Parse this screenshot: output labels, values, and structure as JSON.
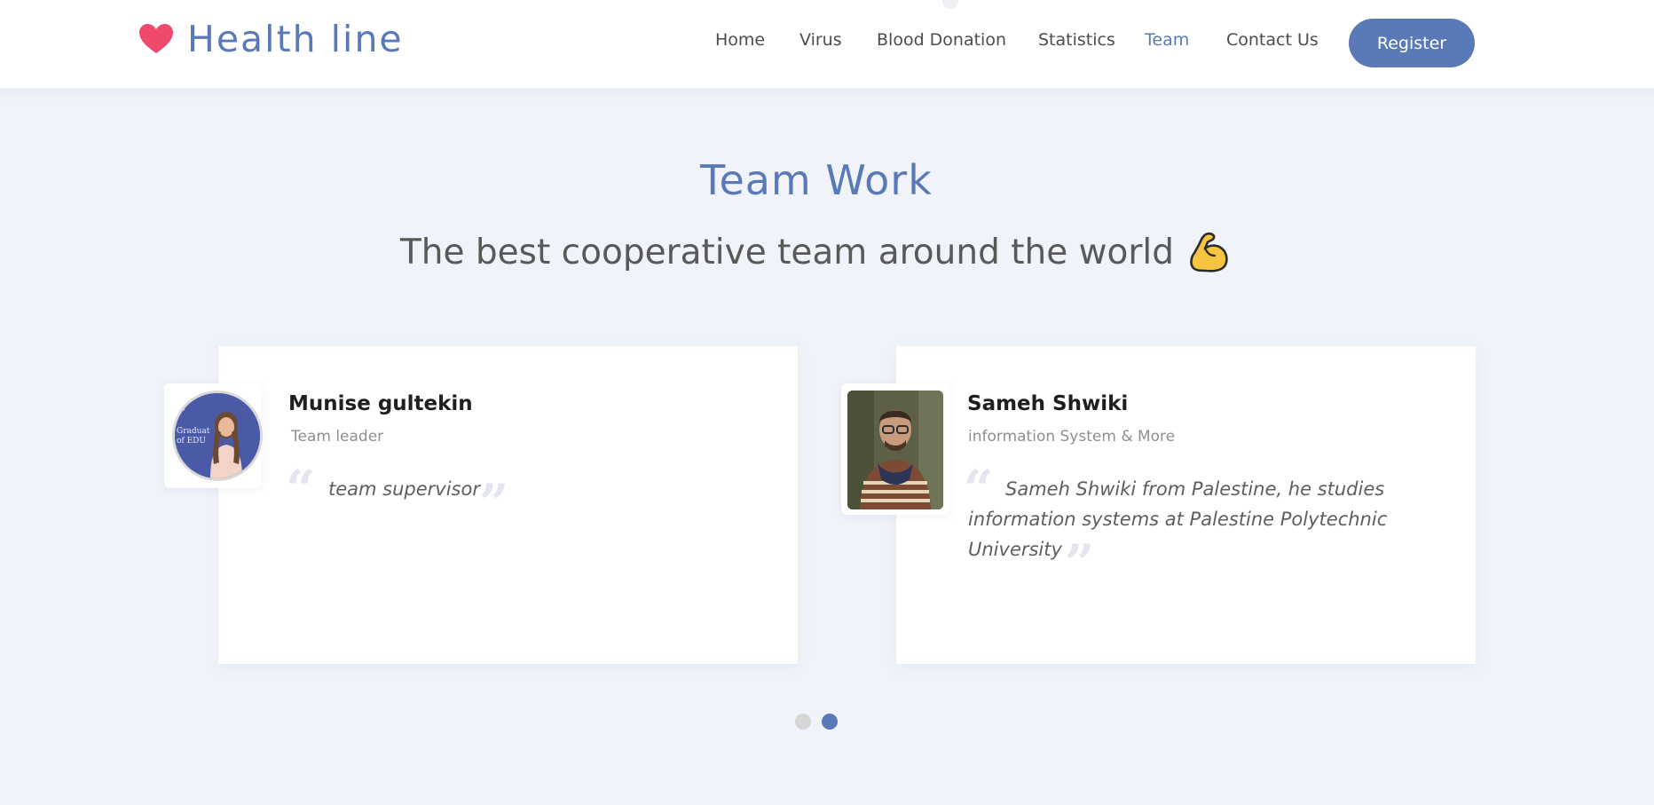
{
  "header": {
    "logo_text": "Health line",
    "nav": [
      {
        "label": "Home"
      },
      {
        "label": "Virus"
      },
      {
        "label": "Blood Donation"
      },
      {
        "label": "Statistics"
      },
      {
        "label": "Team",
        "active": true
      },
      {
        "label": "Contact Us"
      }
    ],
    "register_label": "Register"
  },
  "section": {
    "title": "Team Work",
    "subtitle": "The best cooperative team around the world"
  },
  "team": [
    {
      "name": "Munise gultekin",
      "role": "Team leader",
      "quote": "team supervisor"
    },
    {
      "name": "Sameh Shwiki",
      "role": "information System & More",
      "quote_lines": [
        "Sameh Shwiki from Palestine, he studies",
        "information systems at Palestine Polytechnic",
        "University"
      ]
    }
  ],
  "pagination": {
    "count": 2,
    "active_index": 1
  },
  "colors": {
    "accent": "#5a7ab7",
    "heart": "#f0496e",
    "background": "#f0f3f9",
    "muscle": "#f5c542"
  },
  "icons": {
    "logo": "heart-icon",
    "subtitle": "flexed-biceps-icon",
    "quote_open": "quote-open-icon",
    "quote_close": "quote-close-icon"
  }
}
